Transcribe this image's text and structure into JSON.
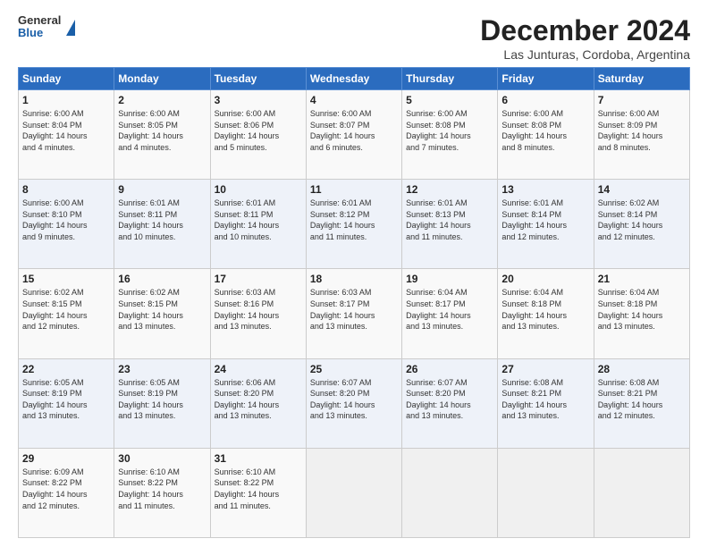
{
  "logo": {
    "line1": "General",
    "line2": "Blue"
  },
  "title": "December 2024",
  "subtitle": "Las Junturas, Cordoba, Argentina",
  "days_header": [
    "Sunday",
    "Monday",
    "Tuesday",
    "Wednesday",
    "Thursday",
    "Friday",
    "Saturday"
  ],
  "weeks": [
    [
      {
        "day": "1",
        "info": "Sunrise: 6:00 AM\nSunset: 8:04 PM\nDaylight: 14 hours\nand 4 minutes."
      },
      {
        "day": "2",
        "info": "Sunrise: 6:00 AM\nSunset: 8:05 PM\nDaylight: 14 hours\nand 4 minutes."
      },
      {
        "day": "3",
        "info": "Sunrise: 6:00 AM\nSunset: 8:06 PM\nDaylight: 14 hours\nand 5 minutes."
      },
      {
        "day": "4",
        "info": "Sunrise: 6:00 AM\nSunset: 8:07 PM\nDaylight: 14 hours\nand 6 minutes."
      },
      {
        "day": "5",
        "info": "Sunrise: 6:00 AM\nSunset: 8:08 PM\nDaylight: 14 hours\nand 7 minutes."
      },
      {
        "day": "6",
        "info": "Sunrise: 6:00 AM\nSunset: 8:08 PM\nDaylight: 14 hours\nand 8 minutes."
      },
      {
        "day": "7",
        "info": "Sunrise: 6:00 AM\nSunset: 8:09 PM\nDaylight: 14 hours\nand 8 minutes."
      }
    ],
    [
      {
        "day": "8",
        "info": "Sunrise: 6:00 AM\nSunset: 8:10 PM\nDaylight: 14 hours\nand 9 minutes."
      },
      {
        "day": "9",
        "info": "Sunrise: 6:01 AM\nSunset: 8:11 PM\nDaylight: 14 hours\nand 10 minutes."
      },
      {
        "day": "10",
        "info": "Sunrise: 6:01 AM\nSunset: 8:11 PM\nDaylight: 14 hours\nand 10 minutes."
      },
      {
        "day": "11",
        "info": "Sunrise: 6:01 AM\nSunset: 8:12 PM\nDaylight: 14 hours\nand 11 minutes."
      },
      {
        "day": "12",
        "info": "Sunrise: 6:01 AM\nSunset: 8:13 PM\nDaylight: 14 hours\nand 11 minutes."
      },
      {
        "day": "13",
        "info": "Sunrise: 6:01 AM\nSunset: 8:14 PM\nDaylight: 14 hours\nand 12 minutes."
      },
      {
        "day": "14",
        "info": "Sunrise: 6:02 AM\nSunset: 8:14 PM\nDaylight: 14 hours\nand 12 minutes."
      }
    ],
    [
      {
        "day": "15",
        "info": "Sunrise: 6:02 AM\nSunset: 8:15 PM\nDaylight: 14 hours\nand 12 minutes."
      },
      {
        "day": "16",
        "info": "Sunrise: 6:02 AM\nSunset: 8:15 PM\nDaylight: 14 hours\nand 13 minutes."
      },
      {
        "day": "17",
        "info": "Sunrise: 6:03 AM\nSunset: 8:16 PM\nDaylight: 14 hours\nand 13 minutes."
      },
      {
        "day": "18",
        "info": "Sunrise: 6:03 AM\nSunset: 8:17 PM\nDaylight: 14 hours\nand 13 minutes."
      },
      {
        "day": "19",
        "info": "Sunrise: 6:04 AM\nSunset: 8:17 PM\nDaylight: 14 hours\nand 13 minutes."
      },
      {
        "day": "20",
        "info": "Sunrise: 6:04 AM\nSunset: 8:18 PM\nDaylight: 14 hours\nand 13 minutes."
      },
      {
        "day": "21",
        "info": "Sunrise: 6:04 AM\nSunset: 8:18 PM\nDaylight: 14 hours\nand 13 minutes."
      }
    ],
    [
      {
        "day": "22",
        "info": "Sunrise: 6:05 AM\nSunset: 8:19 PM\nDaylight: 14 hours\nand 13 minutes."
      },
      {
        "day": "23",
        "info": "Sunrise: 6:05 AM\nSunset: 8:19 PM\nDaylight: 14 hours\nand 13 minutes."
      },
      {
        "day": "24",
        "info": "Sunrise: 6:06 AM\nSunset: 8:20 PM\nDaylight: 14 hours\nand 13 minutes."
      },
      {
        "day": "25",
        "info": "Sunrise: 6:07 AM\nSunset: 8:20 PM\nDaylight: 14 hours\nand 13 minutes."
      },
      {
        "day": "26",
        "info": "Sunrise: 6:07 AM\nSunset: 8:20 PM\nDaylight: 14 hours\nand 13 minutes."
      },
      {
        "day": "27",
        "info": "Sunrise: 6:08 AM\nSunset: 8:21 PM\nDaylight: 14 hours\nand 13 minutes."
      },
      {
        "day": "28",
        "info": "Sunrise: 6:08 AM\nSunset: 8:21 PM\nDaylight: 14 hours\nand 12 minutes."
      }
    ],
    [
      {
        "day": "29",
        "info": "Sunrise: 6:09 AM\nSunset: 8:22 PM\nDaylight: 14 hours\nand 12 minutes."
      },
      {
        "day": "30",
        "info": "Sunrise: 6:10 AM\nSunset: 8:22 PM\nDaylight: 14 hours\nand 11 minutes."
      },
      {
        "day": "31",
        "info": "Sunrise: 6:10 AM\nSunset: 8:22 PM\nDaylight: 14 hours\nand 11 minutes."
      },
      {
        "day": "",
        "info": ""
      },
      {
        "day": "",
        "info": ""
      },
      {
        "day": "",
        "info": ""
      },
      {
        "day": "",
        "info": ""
      }
    ]
  ]
}
